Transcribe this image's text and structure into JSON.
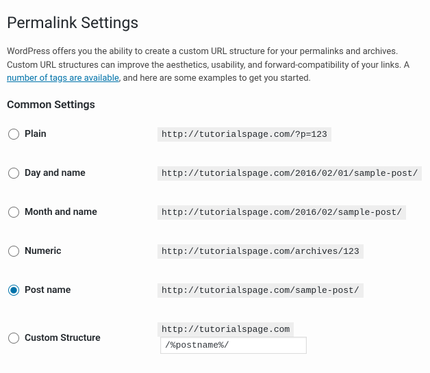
{
  "page": {
    "title": "Permalink Settings",
    "intro_prefix": "WordPress offers you the ability to create a custom URL structure for your permalinks and archives. Custom URL structures can improve the aesthetics, usability, and forward-compatibility of your links. A ",
    "intro_link": "number of tags are available",
    "intro_suffix": ", and here are some examples to get you started."
  },
  "common": {
    "heading": "Common Settings",
    "options": [
      {
        "key": "plain",
        "label": "Plain",
        "example": "http://tutorialspage.com/?p=123",
        "selected": false
      },
      {
        "key": "day-name",
        "label": "Day and name",
        "example": "http://tutorialspage.com/2016/02/01/sample-post/",
        "selected": false
      },
      {
        "key": "month-name",
        "label": "Month and name",
        "example": "http://tutorialspage.com/2016/02/sample-post/",
        "selected": false
      },
      {
        "key": "numeric",
        "label": "Numeric",
        "example": "http://tutorialspage.com/archives/123",
        "selected": false
      },
      {
        "key": "post-name",
        "label": "Post name",
        "example": "http://tutorialspage.com/sample-post/",
        "selected": true
      }
    ],
    "custom": {
      "label": "Custom Structure",
      "base": "http://tutorialspage.com",
      "value": "/%postname%/"
    }
  }
}
